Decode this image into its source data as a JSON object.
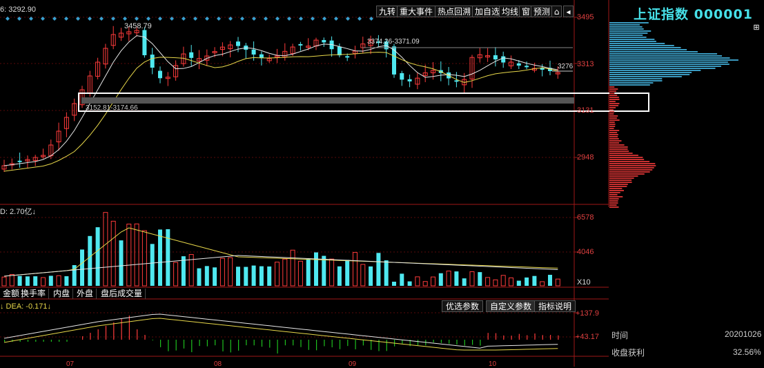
{
  "toolbar": {
    "buttons": [
      "九转",
      "重大事件",
      "热点回溯",
      "加自选",
      "均线",
      "窗",
      "预测"
    ]
  },
  "index": {
    "name_code": "上证指数 000001"
  },
  "price_axis": {
    "labels": [
      "3495",
      "3313",
      "3131",
      "2948"
    ]
  },
  "volume_axis": {
    "labels": [
      "6578",
      "4046",
      "X10"
    ]
  },
  "macd_axis": {
    "labels": [
      "+137.9",
      "+43.17"
    ]
  },
  "readouts": {
    "ma_value": "6: 3292.90",
    "high_label": "3458.79",
    "range_label": "3374.26-3371.09",
    "last_label": "3276",
    "support_zone": "3152.81-3174.66",
    "volume_label": "D: 2.70亿↓",
    "dea_label": "↓ DEA: -0.171↓"
  },
  "indicator_tabs": [
    "金额",
    "换手率",
    "内盘",
    "外盘",
    "盘后成交量"
  ],
  "macd_buttons": [
    "优选参数",
    "自定义参数",
    "指标说明"
  ],
  "info_panel": {
    "time_label": "时间",
    "time_value": "20201026",
    "profit_label": "收盘获利",
    "profit_value": "32.56%"
  },
  "time_axis": {
    "labels": [
      "07",
      "08",
      "09",
      "10"
    ]
  },
  "colors": {
    "up": "#ff3b3b",
    "down": "#4fe8f0",
    "ma_white": "#e8e8e8",
    "ma_yellow": "#e8d84a",
    "axis_red": "#a01818",
    "highlight_box": "#ffffff"
  },
  "icons": [
    "pin-icon",
    "export-icon",
    "expand-icon"
  ]
}
